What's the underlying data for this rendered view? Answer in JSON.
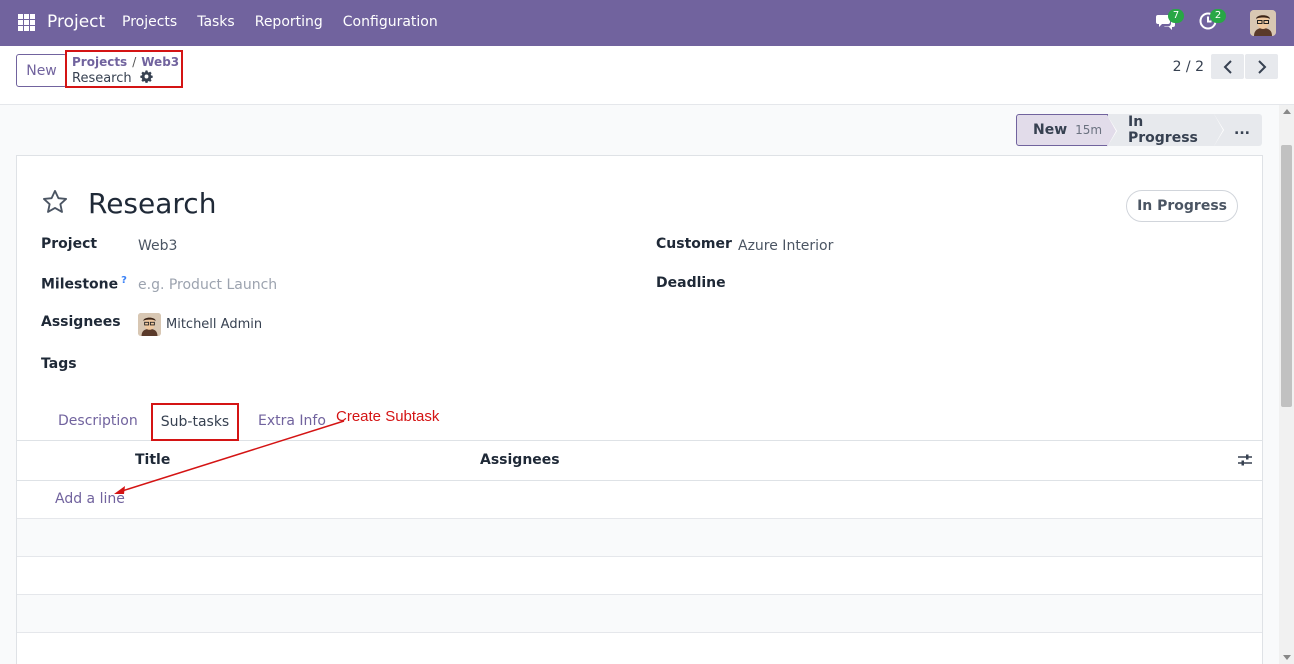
{
  "navbar": {
    "app_name": "Project",
    "menu": [
      "Projects",
      "Tasks",
      "Reporting",
      "Configuration"
    ],
    "messages_count": "7",
    "activities_count": "2"
  },
  "control_panel": {
    "new_label": "New",
    "breadcrumb": [
      "Projects",
      "Web3"
    ],
    "breadcrumb_sep": "/",
    "current": "Research",
    "pager": "2 / 2"
  },
  "statusbar": {
    "stages": [
      {
        "label": "New",
        "time": "15m",
        "active": true
      },
      {
        "label": "In Progress",
        "active": false
      },
      {
        "label": "...",
        "active": false
      }
    ]
  },
  "form": {
    "title": "Research",
    "state_pill": "In Progress",
    "fields": {
      "project_label": "Project",
      "project_value": "Web3",
      "milestone_label": "Milestone",
      "milestone_help": "?",
      "milestone_placeholder": "e.g. Product Launch",
      "assignees_label": "Assignees",
      "assignee_name": "Mitchell Admin",
      "tags_label": "Tags",
      "customer_label": "Customer",
      "customer_value": "Azure Interior",
      "deadline_label": "Deadline"
    },
    "tabs": [
      "Description",
      "Sub-tasks",
      "Extra Info"
    ],
    "active_tab": "Sub-tasks",
    "annotation": "Create Subtask",
    "table": {
      "columns": [
        "Title",
        "Assignees"
      ],
      "add_line": "Add a line"
    }
  },
  "colors": {
    "brand": "#71639e",
    "annotation_red": "#d41414",
    "badge_green": "#28a745"
  }
}
